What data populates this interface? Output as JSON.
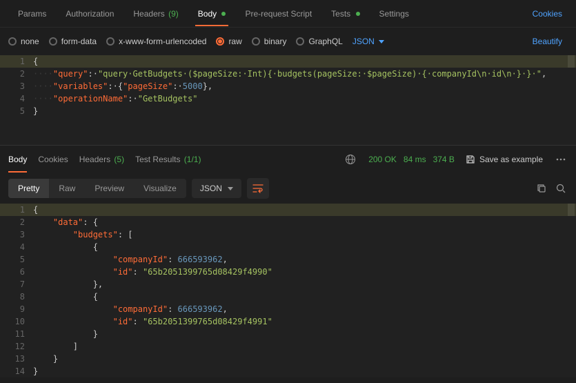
{
  "request": {
    "tabs": {
      "params": "Params",
      "authorization": "Authorization",
      "headers": {
        "label": "Headers",
        "count": "(9)"
      },
      "body": "Body",
      "prerequest": "Pre-request Script",
      "tests": "Tests",
      "settings": "Settings"
    },
    "cookiesLink": "Cookies",
    "bodyTypes": {
      "none": "none",
      "formdata": "form-data",
      "urlencoded": "x-www-form-urlencoded",
      "raw": "raw",
      "binary": "binary",
      "graphql": "GraphQL"
    },
    "rawType": "JSON",
    "beautify": "Beautify",
    "code": {
      "l1": "{",
      "l2": {
        "ws": "····",
        "key": "\"query\"",
        "sep": ":·",
        "val": "\"query·GetBudgets·($pageSize:·Int){·budgets(pageSize:·$pageSize)·{·companyId\\n·id\\n·}·}·\"",
        "end": ","
      },
      "l3": {
        "ws": "····",
        "key": "\"variables\"",
        "sep": ":·",
        "open": "{",
        "k2": "\"pageSize\"",
        "sep2": ":·",
        "val": "5000",
        "close": "},"
      },
      "l4": {
        "ws": "····",
        "key": "\"operationName\"",
        "sep": ":·",
        "val": "\"GetBudgets\""
      },
      "l5": "}"
    }
  },
  "response": {
    "tabs": {
      "body": "Body",
      "cookies": "Cookies",
      "headers": {
        "label": "Headers",
        "count": "(5)"
      },
      "testresults": {
        "label": "Test Results",
        "count": "(1/1)"
      }
    },
    "status": {
      "code": "200 OK",
      "time": "84 ms",
      "size": "374 B"
    },
    "saveExample": "Save as example",
    "viewTabs": {
      "pretty": "Pretty",
      "raw": "Raw",
      "preview": "Preview",
      "visualize": "Visualize"
    },
    "format": "JSON",
    "code": {
      "l1": "{",
      "l2": {
        "ws": "    ",
        "key": "\"data\"",
        "sep": ": ",
        "val": "{"
      },
      "l3": {
        "ws": "        ",
        "key": "\"budgets\"",
        "sep": ": ",
        "val": "["
      },
      "l4": {
        "ws": "            ",
        "val": "{"
      },
      "l5": {
        "ws": "                ",
        "key": "\"companyId\"",
        "sep": ": ",
        "val": "666593962",
        "end": ","
      },
      "l6": {
        "ws": "                ",
        "key": "\"id\"",
        "sep": ": ",
        "val": "\"65b2051399765d08429f4990\""
      },
      "l7": {
        "ws": "            ",
        "val": "},"
      },
      "l8": {
        "ws": "            ",
        "val": "{"
      },
      "l9": {
        "ws": "                ",
        "key": "\"companyId\"",
        "sep": ": ",
        "val": "666593962",
        "end": ","
      },
      "l10": {
        "ws": "                ",
        "key": "\"id\"",
        "sep": ": ",
        "val": "\"65b2051399765d08429f4991\""
      },
      "l11": {
        "ws": "            ",
        "val": "}"
      },
      "l12": {
        "ws": "        ",
        "val": "]"
      },
      "l13": {
        "ws": "    ",
        "val": "}"
      },
      "l14": "}"
    }
  }
}
